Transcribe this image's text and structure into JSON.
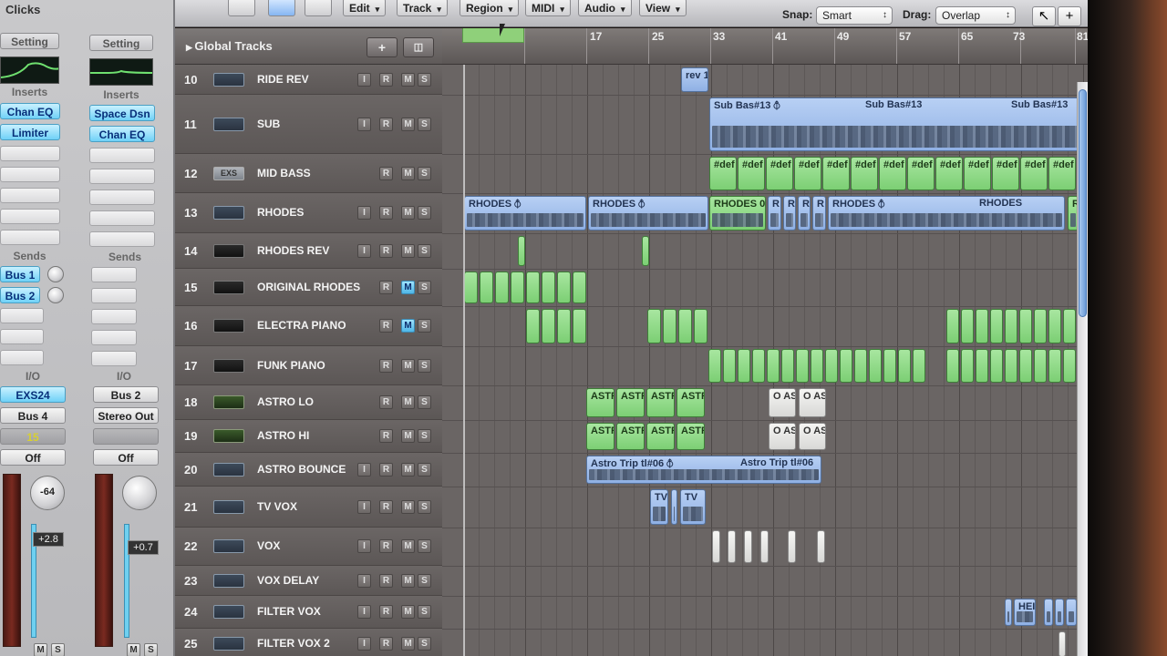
{
  "mixer": {
    "title": "Clicks",
    "strips": [
      {
        "setting": "Setting",
        "inserts_label": "Inserts",
        "inserts": [
          "Chan EQ",
          "Limiter"
        ],
        "sends_label": "Sends",
        "sends": [
          "Bus 1",
          "Bus 2"
        ],
        "io_label": "I/O",
        "input": "EXS24",
        "output": "Bus 4",
        "group": "15",
        "automation": "Off",
        "pan": "-64",
        "fader_value": "+2.8"
      },
      {
        "setting": "Setting",
        "inserts_label": "Inserts",
        "inserts": [
          "Space Dsn",
          "Chan EQ"
        ],
        "sends_label": "Sends",
        "sends": [],
        "io_label": "I/O",
        "input": "Bus 2",
        "output": "Stereo Out",
        "group": "",
        "automation": "Off",
        "pan": "",
        "fader_value": "+0.7"
      }
    ],
    "mute_label": "M",
    "solo_label": "S"
  },
  "toolbar": {
    "menus": [
      "Edit",
      "Track",
      "Region",
      "MIDI",
      "Audio",
      "View"
    ],
    "snap_label": "Snap:",
    "snap_value": "Smart",
    "drag_label": "Drag:",
    "drag_value": "Overlap"
  },
  "global_tracks": {
    "label": "Global Tracks"
  },
  "ruler": {
    "bars": [
      "17",
      "25",
      "33",
      "41",
      "49",
      "57",
      "65",
      "73",
      "81"
    ]
  },
  "button_labels": {
    "i": "I",
    "r": "R",
    "m": "M",
    "s": "S"
  },
  "tracks": [
    {
      "num": "10",
      "name": "RIDE REV",
      "icon": "audio"
    },
    {
      "num": "11",
      "name": "SUB",
      "icon": "audio"
    },
    {
      "num": "12",
      "name": "MID BASS",
      "icon": "exs"
    },
    {
      "num": "13",
      "name": "RHODES",
      "icon": "audio"
    },
    {
      "num": "14",
      "name": "RHODES REV",
      "icon": "inst"
    },
    {
      "num": "15",
      "name": "ORIGINAL RHODES",
      "icon": "inst"
    },
    {
      "num": "16",
      "name": "ELECTRA PIANO",
      "icon": "inst"
    },
    {
      "num": "17",
      "name": "FUNK PIANO",
      "icon": "inst"
    },
    {
      "num": "18",
      "name": "ASTRO LO",
      "icon": "astro"
    },
    {
      "num": "19",
      "name": "ASTRO HI",
      "icon": "astro"
    },
    {
      "num": "20",
      "name": "ASTRO BOUNCE",
      "icon": "audio"
    },
    {
      "num": "21",
      "name": "TV VOX",
      "icon": "audio"
    },
    {
      "num": "22",
      "name": "VOX",
      "icon": "audio"
    },
    {
      "num": "23",
      "name": "VOX DELAY",
      "icon": "audio"
    },
    {
      "num": "24",
      "name": "FILTER VOX",
      "icon": "audio"
    },
    {
      "num": "25",
      "name": "FILTER VOX 2",
      "icon": "audio"
    }
  ],
  "region_names": {
    "rev": "rev 1",
    "sub1": "Sub Bas#13 ⦽",
    "sub2": "Sub Bas#13",
    "sub3": "Sub Bas#13",
    "def": "#def",
    "rhodes": "RHODES ⦽",
    "rhodes_short": "RHODES 0",
    "rhodes_r": "R",
    "rhodes2": "RHODES ⦽",
    "rhodes3": "RHODES",
    "astro": "ASTR",
    "astro_o": "O AS",
    "astro_trip1": "Astro Trip tl#06 ⦽",
    "astro_trip2": "Astro Trip tl#06",
    "tv": "TV",
    "hei": "HEI"
  },
  "colors": {
    "audio_region": "#a8c4f0",
    "midi_region": "#8fdc86",
    "selected_button": "#6fd1f7"
  }
}
